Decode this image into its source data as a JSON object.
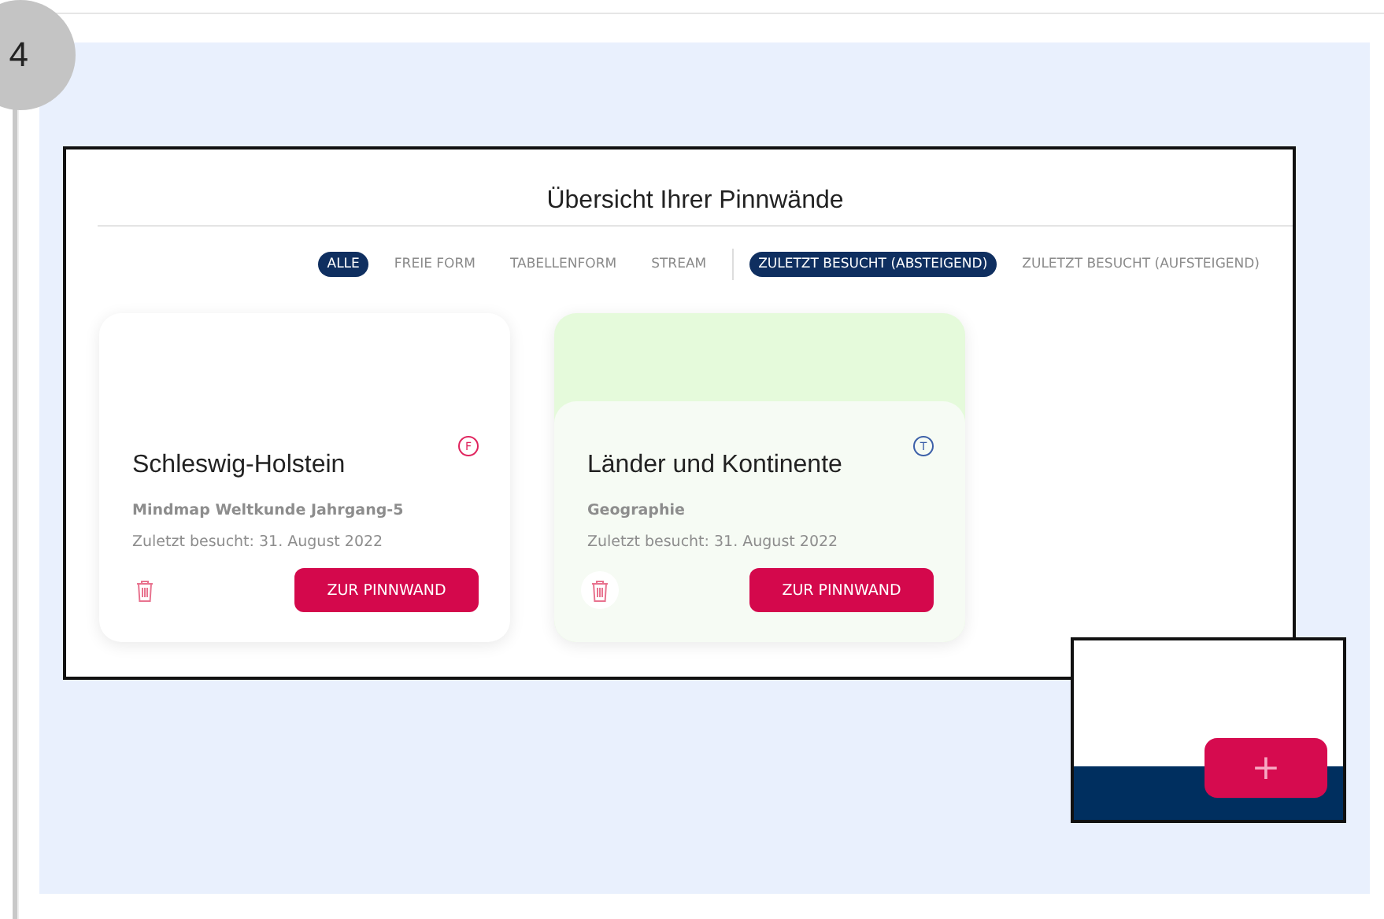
{
  "step": {
    "number": "4"
  },
  "overview": {
    "title": "Übersicht Ihrer Pinnwände",
    "type_filters": [
      {
        "label": "ALLE",
        "selected": true
      },
      {
        "label": "FREIE FORM",
        "selected": false
      },
      {
        "label": "TABELLENFORM",
        "selected": false
      },
      {
        "label": "STREAM",
        "selected": false
      }
    ],
    "sort_filters": [
      {
        "label": "ZULETZT BESUCHT (ABSTEIGEND)",
        "selected": true
      },
      {
        "label": "ZULETZT BESUCHT (AUFSTEIGEND)",
        "selected": false
      }
    ],
    "boards": [
      {
        "title": "Schleswig-Holstein",
        "badge": {
          "letter": "F",
          "color": "#e0245e"
        },
        "color": "#ffffff",
        "subtitle": "Mindmap Weltkunde Jahrgang-5",
        "visited": "Zuletzt besucht: 31. August 2022",
        "button": "ZUR PINNWAND"
      },
      {
        "title": "Länder und Kontinente",
        "badge": {
          "letter": "T",
          "color": "#3b5fa8"
        },
        "color": "#e5fadb",
        "subtitle": "Geographie",
        "visited": "Zuletzt besucht: 31. August 2022",
        "button": "ZUR PINNWAND"
      }
    ]
  },
  "add_button": {
    "label": "+"
  }
}
